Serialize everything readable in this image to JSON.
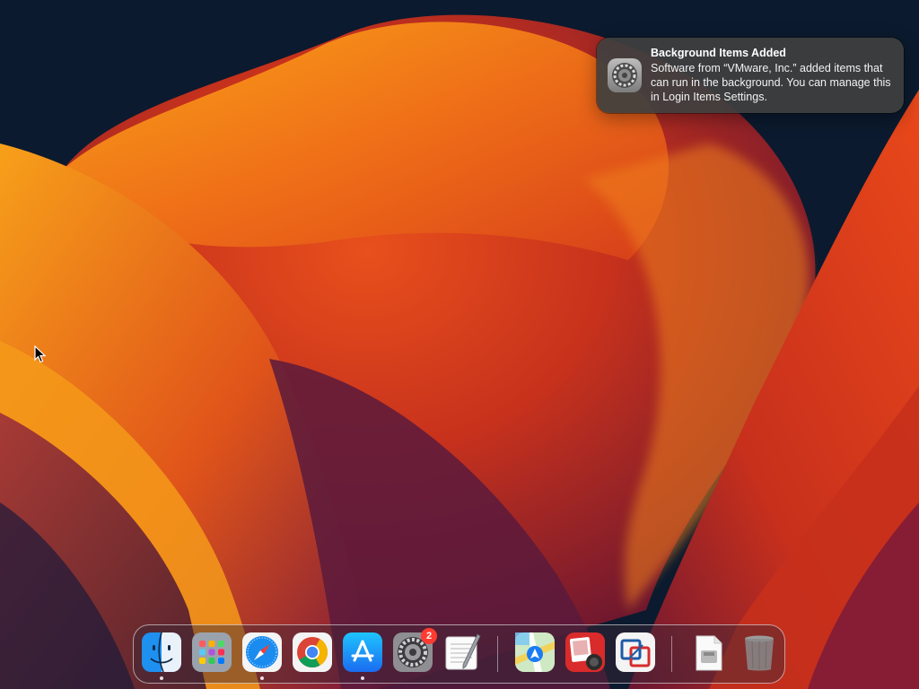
{
  "desktop": {
    "wallpaper": "macOS Ventura",
    "colors": {
      "background": "#0b1a2e",
      "orange": "#f28a13",
      "red": "#c8321c",
      "purple": "#5a1a3c"
    }
  },
  "notification": {
    "icon": "system-settings-icon",
    "title": "Background Items Added",
    "body": "Software from “VMware, Inc.” added items that can run in the background. You can manage this in Login Items Settings."
  },
  "dock": {
    "apps": [
      {
        "name": "Finder",
        "icon": "finder-icon",
        "running": true
      },
      {
        "name": "Launchpad",
        "icon": "launchpad-icon",
        "running": false
      },
      {
        "name": "Safari",
        "icon": "safari-icon",
        "running": true
      },
      {
        "name": "Google Chrome",
        "icon": "chrome-icon",
        "running": false
      },
      {
        "name": "App Store",
        "icon": "app-store-icon",
        "running": true
      },
      {
        "name": "System Settings",
        "icon": "system-settings-icon",
        "running": false,
        "badge": "2"
      },
      {
        "name": "TextEdit",
        "icon": "textedit-icon",
        "running": false
      }
    ],
    "recent_apps": [
      {
        "name": "Maps",
        "icon": "maps-icon"
      },
      {
        "name": "Photo Booth",
        "icon": "photo-booth-icon"
      },
      {
        "name": "VMware Fusion",
        "icon": "vmware-fusion-icon"
      }
    ],
    "stack_items": [
      {
        "name": "Downloads",
        "icon": "downloads-stack-icon"
      },
      {
        "name": "Trash",
        "icon": "trash-icon"
      }
    ],
    "badge_color": "#ff3b30"
  }
}
